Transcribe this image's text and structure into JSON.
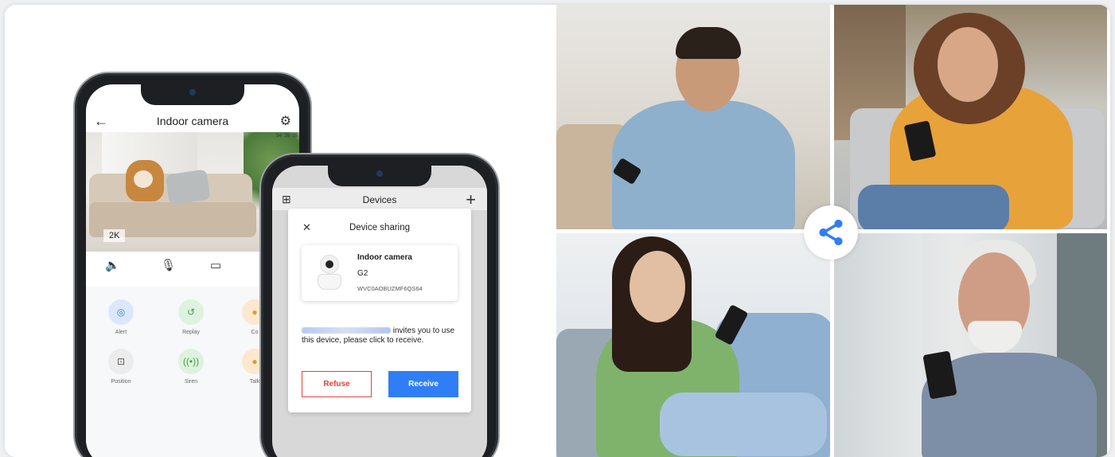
{
  "camera_app": {
    "title": "Indoor camera",
    "timestamp": "54: 26: 35",
    "resolution": "2K",
    "features": [
      {
        "label": "Alert",
        "color": "#dbe8fb",
        "icon_color": "#3b7ee8"
      },
      {
        "label": "Replay",
        "color": "#dff2df",
        "icon_color": "#3ba34a"
      },
      {
        "label": "Co",
        "color": "#fce8cf",
        "icon_color": "#e59a2c"
      },
      {
        "label": "Position",
        "color": "#ececec",
        "icon_color": "#555555"
      },
      {
        "label": "Siren",
        "color": "#dff2df",
        "icon_color": "#3ba34a"
      },
      {
        "label": "Talk",
        "color": "#fce8cf",
        "icon_color": "#e59a2c"
      }
    ]
  },
  "devices_app": {
    "title": "Devices",
    "dialog": {
      "title": "Device sharing",
      "device_name": "Indoor camera",
      "device_model": "G2",
      "device_serial": "WVC0AOBUZMF6QS64",
      "invite_text": " invites you to use this device, please click to receive.",
      "refuse_label": "Refuse",
      "receive_label": "Receive"
    }
  },
  "colors": {
    "accent": "#2f7ef5",
    "danger": "#e0453c",
    "share": "#2f7ef5"
  }
}
